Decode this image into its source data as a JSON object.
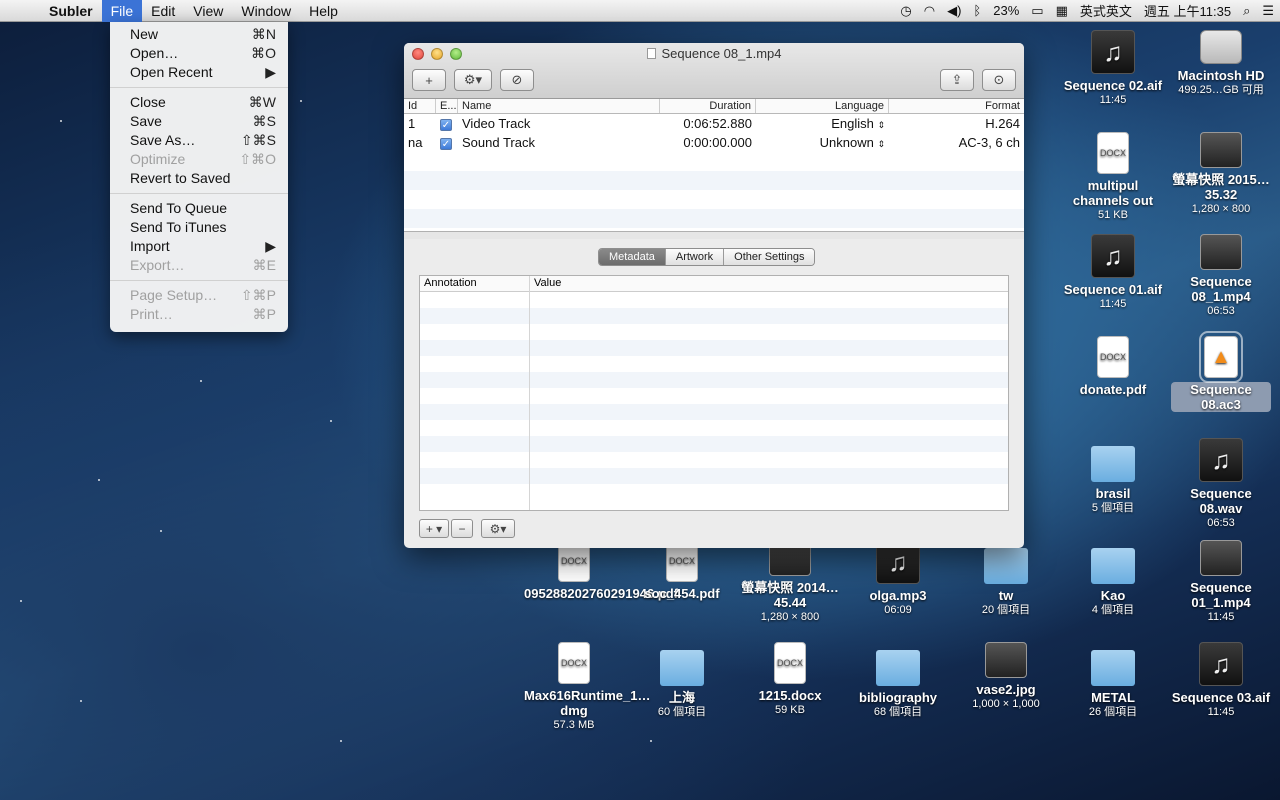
{
  "menubar": {
    "app": "Subler",
    "menus": [
      "File",
      "Edit",
      "View",
      "Window",
      "Help"
    ],
    "battery": "23%",
    "input_method": "英式英文",
    "clock": "週五 上午11:35"
  },
  "file_menu": {
    "groups": [
      [
        {
          "label": "New",
          "shortcut": "⌘N",
          "enabled": true
        },
        {
          "label": "Open…",
          "shortcut": "⌘O",
          "enabled": true
        },
        {
          "label": "Open Recent",
          "shortcut": "▶",
          "enabled": true
        }
      ],
      [
        {
          "label": "Close",
          "shortcut": "⌘W",
          "enabled": true
        },
        {
          "label": "Save",
          "shortcut": "⌘S",
          "enabled": true
        },
        {
          "label": "Save As…",
          "shortcut": "⇧⌘S",
          "enabled": true
        },
        {
          "label": "Optimize",
          "shortcut": "⇧⌘O",
          "enabled": false
        },
        {
          "label": "Revert to Saved",
          "shortcut": "",
          "enabled": true
        }
      ],
      [
        {
          "label": "Send To Queue",
          "shortcut": "",
          "enabled": true
        },
        {
          "label": "Send To iTunes",
          "shortcut": "",
          "enabled": true
        },
        {
          "label": "Import",
          "shortcut": "▶",
          "enabled": true
        },
        {
          "label": "Export…",
          "shortcut": "⌘E",
          "enabled": false
        }
      ],
      [
        {
          "label": "Page Setup…",
          "shortcut": "⇧⌘P",
          "enabled": false
        },
        {
          "label": "Print…",
          "shortcut": "⌘P",
          "enabled": false
        }
      ]
    ]
  },
  "window": {
    "title": "Sequence 08_1.mp4",
    "toolbar": {
      "add": "+",
      "gear": "⚙▾",
      "remove": "⊘",
      "share": "⇪",
      "search": "⊙"
    },
    "tracks_header": {
      "id": "Id",
      "enabled": "E...",
      "name": "Name",
      "duration": "Duration",
      "language": "Language",
      "format": "Format"
    },
    "tracks": [
      {
        "id": "1",
        "name": "Video Track",
        "duration": "0:06:52.880",
        "language": "English",
        "format": "H.264"
      },
      {
        "id": "na",
        "name": "Sound Track",
        "duration": "0:00:00.000",
        "language": "Unknown",
        "format": "AC-3, 6 ch"
      }
    ],
    "tabs": [
      "Metadata",
      "Artwork",
      "Other Settings"
    ],
    "metadata_header": {
      "annotation": "Annotation",
      "value": "Value"
    },
    "bottom": {
      "add": "+ ▾",
      "remove": "−",
      "gear": "⚙▾"
    }
  },
  "desktop": [
    {
      "name": "Sequence 02.aif",
      "sub": "11:45",
      "type": "music"
    },
    {
      "name": "Macintosh HD",
      "sub": "499.25…GB 可用",
      "type": "disk"
    },
    {
      "name": "multipul channels out",
      "sub": "51 KB",
      "type": "doc"
    },
    {
      "name": "螢幕快照 2015…35.32",
      "sub": "1,280 × 800",
      "type": "photo"
    },
    {
      "name": "Sequence 01.aif",
      "sub": "11:45",
      "type": "music"
    },
    {
      "name": "Sequence 08_1.mp4",
      "sub": "06:53",
      "type": "photo"
    },
    {
      "name": "donate.pdf",
      "sub": "",
      "type": "doc"
    },
    {
      "name": "Sequence 08.ac3",
      "sub": "",
      "type": "vlc"
    },
    {
      "name": "brasil",
      "sub": "5 個項目",
      "type": "folder"
    },
    {
      "name": "Sequence 08.wav",
      "sub": "06:53",
      "type": "music"
    },
    {
      "name": "Kao",
      "sub": "4 個項目",
      "type": "folder"
    },
    {
      "name": "Sequence 01_1.mp4",
      "sub": "11:45",
      "type": "photo"
    },
    {
      "name": "METAL",
      "sub": "26 個項目",
      "type": "folder"
    },
    {
      "name": "Sequence 03.aif",
      "sub": "11:45",
      "type": "music"
    },
    {
      "name": "095288202760291946.pdf",
      "sub": "",
      "type": "doc"
    },
    {
      "name": "soc_454.pdf",
      "sub": "",
      "type": "doc"
    },
    {
      "name": "螢幕快照 2014…45.44",
      "sub": "1,280 × 800",
      "type": "photo"
    },
    {
      "name": "olga.mp3",
      "sub": "06:09",
      "type": "music"
    },
    {
      "name": "tw",
      "sub": "20 個項目",
      "type": "folder"
    },
    {
      "name": "Max616Runtime_1…dmg",
      "sub": "57.3 MB",
      "type": "doc"
    },
    {
      "name": "上海",
      "sub": "60 個項目",
      "type": "folder"
    },
    {
      "name": "1215.docx",
      "sub": "59 KB",
      "type": "doc"
    },
    {
      "name": "bibliography",
      "sub": "68 個項目",
      "type": "folder"
    },
    {
      "name": "vase2.jpg",
      "sub": "1,000 × 1,000",
      "type": "photo"
    }
  ]
}
